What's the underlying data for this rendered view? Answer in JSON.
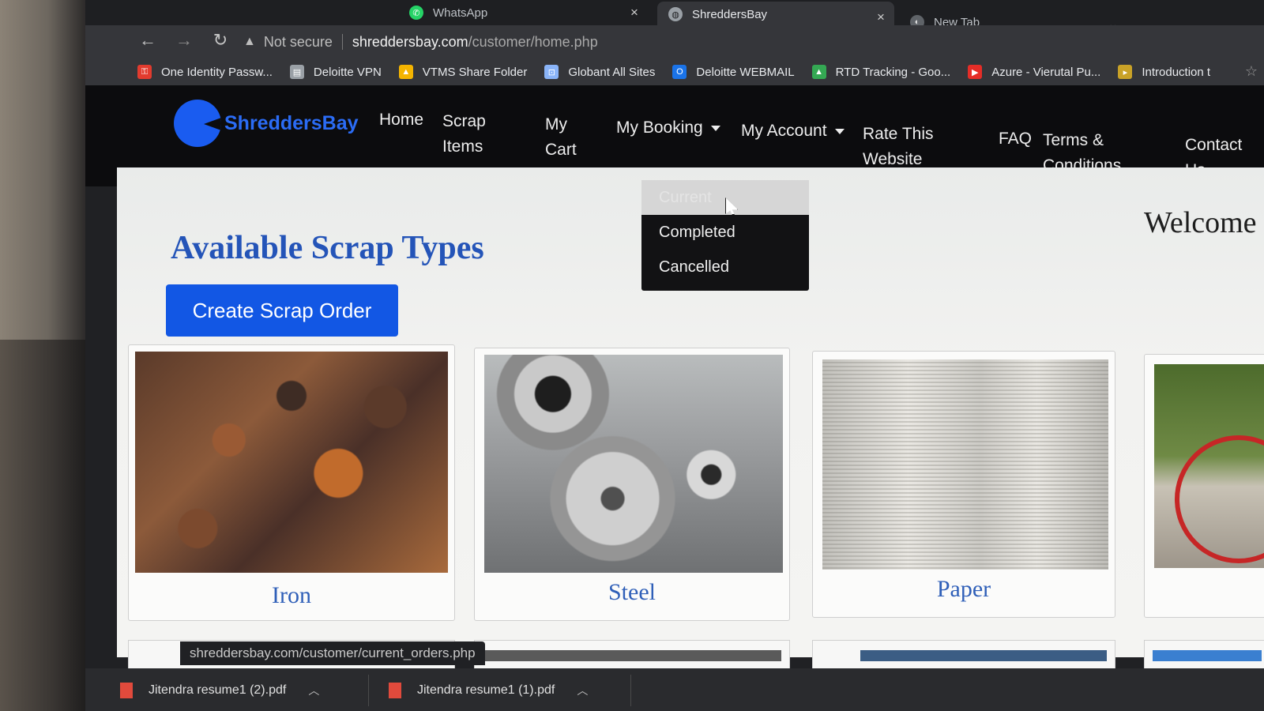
{
  "browser": {
    "tabs": [
      {
        "title": "WhatsApp",
        "icon": "whatsapp-icon",
        "close": "×"
      },
      {
        "title": "ShreddersBay",
        "icon": "globe-icon",
        "close": "×"
      },
      {
        "title": "New Tab",
        "icon": "incognito-icon",
        "close": "×"
      }
    ],
    "new_tab": "+",
    "nav": {
      "back": "←",
      "forward": "→",
      "reload": "↻"
    },
    "security_label": "Not secure",
    "url_host": "shreddersbay.com",
    "url_path": "/customer/home.php",
    "bookmarks": [
      {
        "label": "One Identity Passw...",
        "icon": "key-icon",
        "color": "#e23b2e"
      },
      {
        "label": "Deloitte VPN",
        "icon": "doc-icon",
        "color": "#9aa0a6"
      },
      {
        "label": "VTMS Share Folder",
        "icon": "drive-icon",
        "color": "#f4b400"
      },
      {
        "label": "Globant All Sites",
        "icon": "lock-icon",
        "color": "#8ab4f8"
      },
      {
        "label": "Deloitte WEBMAIL",
        "icon": "outlook-icon",
        "color": "#1a73e8"
      },
      {
        "label": "RTD Tracking - Goo...",
        "icon": "drive-icon",
        "color": "#34a853"
      },
      {
        "label": "Azure - Vierutal Pu...",
        "icon": "youtube-icon",
        "color": "#e52d27"
      },
      {
        "label": "Introduction t",
        "icon": "bookmark-icon",
        "color": "#c9a227"
      }
    ]
  },
  "site": {
    "logo": "ShreddersBay",
    "nav": {
      "home": "Home",
      "scrap_items_1": "Scrap",
      "scrap_items_2": "Items",
      "my_cart_1": "My",
      "my_cart_2": "Cart",
      "my_booking": "My Booking",
      "my_account": "My Account",
      "rate_1": "Rate This",
      "rate_2": "Website",
      "faq": "FAQ",
      "terms_1": "Terms &",
      "terms_2": "Conditions",
      "contact_1": "Contact",
      "contact_2": "Us"
    },
    "dropdown": [
      "Current",
      "Completed",
      "Cancelled"
    ],
    "welcome": "Welcome N",
    "page_title": "Available Scrap Types",
    "create_button": "Create Scrap Order",
    "cards": [
      "Iron",
      "Steel",
      "Paper"
    ]
  },
  "status_url": "shreddersbay.com/customer/current_orders.php",
  "downloads": [
    {
      "name": "Jitendra resume1 (2).pdf"
    },
    {
      "name": "Jitendra resume1 (1).pdf"
    }
  ]
}
